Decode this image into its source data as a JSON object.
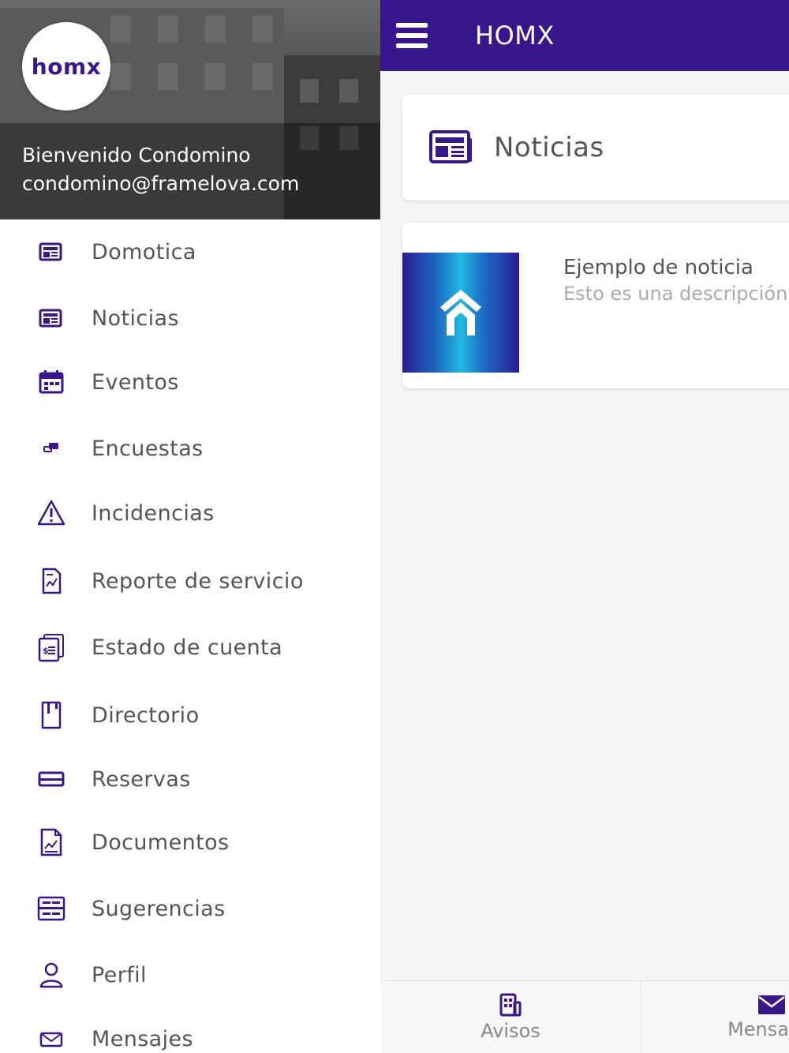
{
  "app": {
    "title": "HOMX",
    "brand_color": "#3a168c"
  },
  "section": {
    "title": "Noticias",
    "icon": "newspaper-icon"
  },
  "news": [
    {
      "title": "Ejemplo de noticia",
      "description": "Esto es una descripción"
    }
  ],
  "drawer": {
    "logo_text": "homx",
    "user_name": "Bienvenido Condomino",
    "user_email": "condomino@framelova.com",
    "items": [
      {
        "label": "Domotica",
        "icon": "newspaper-icon"
      },
      {
        "label": "Noticias",
        "icon": "newspaper-icon"
      },
      {
        "label": "Eventos",
        "icon": "calendar-icon"
      },
      {
        "label": "Encuestas",
        "icon": "chat-icon"
      },
      {
        "label": "Incidencias",
        "icon": "warning-icon"
      },
      {
        "label": "Reporte de servicio",
        "icon": "report-icon"
      },
      {
        "label": "Estado de cuenta",
        "icon": "invoice-icon"
      },
      {
        "label": "Directorio",
        "icon": "directory-icon"
      },
      {
        "label": "Reservas",
        "icon": "ticket-icon"
      },
      {
        "label": "Documentos",
        "icon": "document-icon"
      },
      {
        "label": "Sugerencias",
        "icon": "suggestion-box-icon"
      },
      {
        "label": "Perfil",
        "icon": "user-icon"
      },
      {
        "label": "Mensajes",
        "icon": "envelope-icon"
      }
    ]
  },
  "tabs": [
    {
      "label": "Avisos",
      "icon": "building-icon"
    },
    {
      "label": "Mensajes",
      "icon": "envelope-icon"
    }
  ]
}
